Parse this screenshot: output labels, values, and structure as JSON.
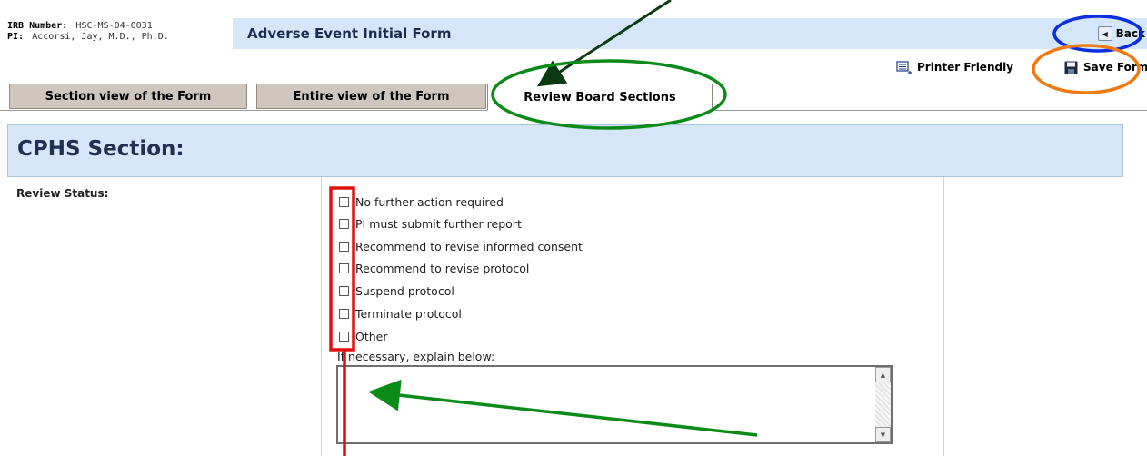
{
  "header": {
    "irb_label": "IRB Number:",
    "irb_value": "HSC-MS-04-0031",
    "pi_label": "PI:",
    "pi_value": "Accorsi, Jay, M.D., Ph.D.",
    "form_title": "Adverse Event Initial Form",
    "back_label": "Back"
  },
  "toolbar": {
    "printer_label": "Printer Friendly",
    "save_label": "Save Form"
  },
  "tabs": [
    {
      "label": "Section view of the Form",
      "active": false
    },
    {
      "label": "Entire view of the Form",
      "active": false
    },
    {
      "label": "Review Board Sections",
      "active": true
    }
  ],
  "section": {
    "title": "CPHS Section:",
    "review_label": "Review Status:",
    "options": [
      {
        "label": "No further action required",
        "checked": false
      },
      {
        "label": "PI must submit further report",
        "checked": false
      },
      {
        "label": "Recommend to revise informed consent",
        "checked": false
      },
      {
        "label": "Recommend to revise protocol",
        "checked": false
      },
      {
        "label": "Suspend protocol",
        "checked": false
      },
      {
        "label": "Terminate protocol",
        "checked": false
      },
      {
        "label": "Other",
        "checked": false
      }
    ],
    "explain_label": "If necessary, explain below:",
    "explain_value": ""
  },
  "colors": {
    "header_bar": "#d4e6f8",
    "tab_inactive": "#cfc7bd",
    "section_head": "#d5e6f8",
    "annot_green": "#0a8a16",
    "annot_blue": "#0b2ee0",
    "annot_orange": "#f07a12",
    "annot_red": "#e01010"
  }
}
